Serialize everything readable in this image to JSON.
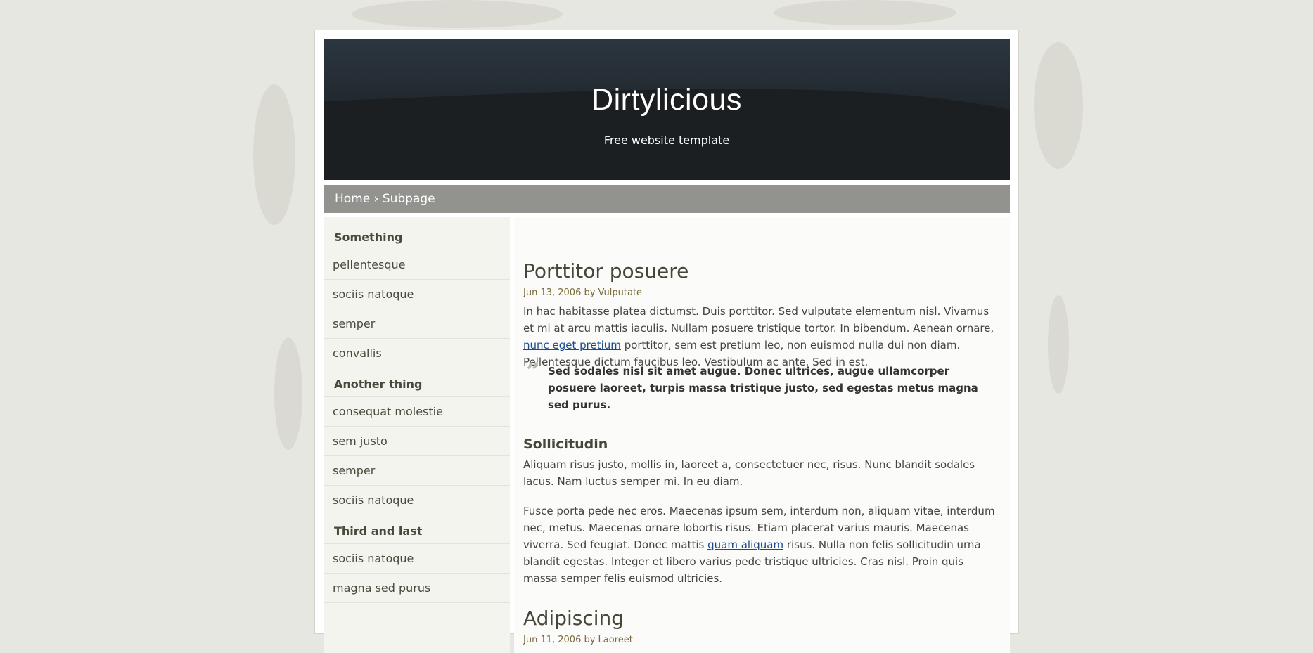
{
  "site": {
    "title": "Dirtylicious",
    "tagline": "Free website template"
  },
  "breadcrumb": {
    "home": "Home",
    "separator": "›",
    "current": "Subpage"
  },
  "sidebar": {
    "groups": [
      {
        "title": "Something",
        "items": [
          "pellentesque",
          "sociis natoque",
          "semper",
          "convallis"
        ]
      },
      {
        "title": "Another thing",
        "items": [
          "consequat molestie",
          "sem justo",
          "semper",
          "sociis natoque"
        ]
      },
      {
        "title": "Third and last",
        "items": [
          "sociis natoque",
          "magna sed purus"
        ]
      }
    ]
  },
  "posts": [
    {
      "title": "Porttitor posuere",
      "meta": "Jun 13, 2006 by Vulputate",
      "p1_a": "In hac habitasse platea dictumst. Duis porttitor. Sed vulputate elementum nisl. Vivamus et mi at arcu mattis iaculis. Nullam posuere tristique tortor. In bibendum. Aenean ornare, ",
      "p1_link": "nunc eget pretium",
      "p1_b": " porttitor, sem est pretium leo, non euismod nulla dui non diam. Pellentesque dictum faucibus leo. Vestibulum ac ante. Sed in est.",
      "quote": "Sed sodales nisl sit amet augue. Donec ultrices, augue ullamcorper posuere laoreet, turpis massa tristique justo, sed egestas metus magna sed purus.",
      "subheading": "Sollicitudin",
      "p2": "Aliquam risus justo, mollis in, laoreet a, consectetuer nec, risus. Nunc blandit sodales lacus. Nam luctus semper mi. In eu diam.",
      "p3_a": "Fusce porta pede nec eros. Maecenas ipsum sem, interdum non, aliquam vitae, interdum nec, metus. Maecenas ornare lobortis risus. Etiam placerat varius mauris. Maecenas viverra. Sed feugiat. Donec mattis ",
      "p3_link": "quam aliquam",
      "p3_b": " risus. Nulla non felis sollicitudin urna blandit egestas. Integer et libero varius pede tristique ultricies. Cras nisl. Proin quis massa semper felis euismod ultricies."
    },
    {
      "title": "Adipiscing",
      "meta": "Jun 11, 2006 by Laoreet"
    }
  ],
  "colors": {
    "header_bg": "#1b1f22",
    "breadcrumb_bg": "#92928e",
    "sidebar_bg": "#f4f4ef",
    "link": "#1a4a8a",
    "heading": "#46463a"
  }
}
